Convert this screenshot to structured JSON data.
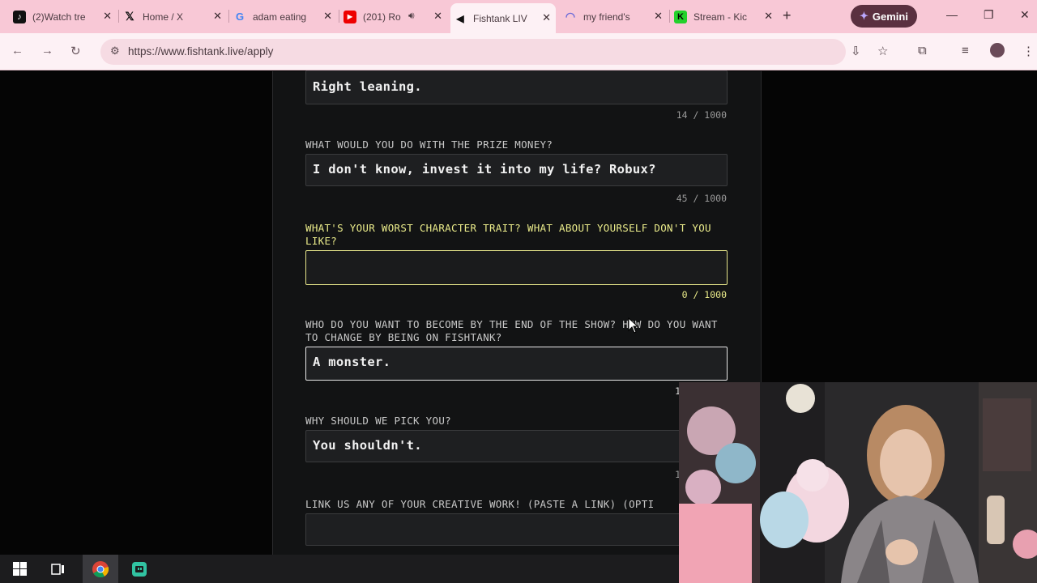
{
  "browser": {
    "tabs": [
      {
        "title": "(2)Watch tre",
        "icon": "tiktok-icon",
        "icon_glyph": "♪"
      },
      {
        "title": "Home / X",
        "icon": "x-icon",
        "icon_glyph": "𝕏"
      },
      {
        "title": "adam eating",
        "icon": "google-icon",
        "icon_glyph": "G"
      },
      {
        "title": "(201) Ro",
        "icon": "youtube-icon",
        "icon_glyph": "▶"
      },
      {
        "title": "Fishtank LIV",
        "icon": "fishtank-icon",
        "icon_glyph": "◀"
      },
      {
        "title": "my friend's",
        "icon": "headset-icon",
        "icon_glyph": "◠"
      },
      {
        "title": "Stream - Kic",
        "icon": "kick-icon",
        "icon_glyph": "K"
      }
    ],
    "gemini_label": "Gemini",
    "url": "https://www.fishtank.live/apply"
  },
  "form": {
    "q0": {
      "answer": "Right leaning.",
      "count": "14 / 1000"
    },
    "q1": {
      "label": "WHAT WOULD YOU DO WITH THE PRIZE MONEY?",
      "answer": "I don't know, invest it into my life?  Robux?",
      "count": "45 / 1000"
    },
    "q2": {
      "label": "WHAT'S YOUR WORST CHARACTER TRAIT? WHAT ABOUT YOURSELF DON'T YOU LIKE?",
      "answer": "",
      "count": "0 / 1000"
    },
    "q3": {
      "label": "WHO DO YOU WANT TO BECOME BY THE END OF THE SHOW? HOW DO YOU WANT TO CHANGE BY BEING ON FISHTANK?",
      "answer": "A monster.",
      "count": "1"
    },
    "q4": {
      "label": "WHY SHOULD WE PICK YOU?",
      "answer": "You shouldn't.",
      "count": "1"
    },
    "q5": {
      "label": "LINK US ANY OF YOUR CREATIVE WORK! (PASTE A LINK) (OPTI",
      "answer": ""
    }
  },
  "colors": {
    "accent_yellow": "#eaeb8a",
    "tab_strip": "#f8c8d6"
  }
}
